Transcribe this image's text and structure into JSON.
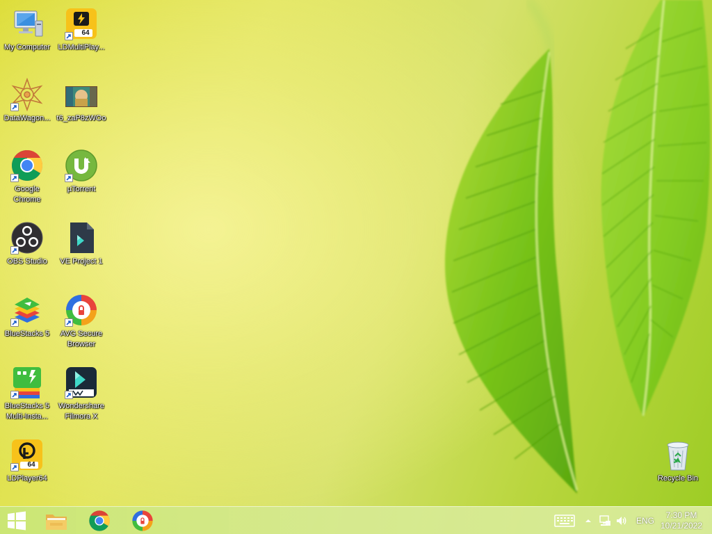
{
  "desktop": {
    "icons": [
      {
        "label": "My Computer",
        "icon": "computer-icon"
      },
      {
        "label": "LDMultiPlay...",
        "icon": "ldmultiplayer-icon",
        "badge": "64"
      },
      {
        "label": "DataWagon...",
        "icon": "datawagon-icon"
      },
      {
        "label": "t6_zaP8zWOo",
        "icon": "image-file-icon"
      },
      {
        "label": "Google Chrome",
        "icon": "chrome-icon"
      },
      {
        "label": "µTorrent",
        "icon": "utorrent-icon"
      },
      {
        "label": "OBS Studio",
        "icon": "obs-icon"
      },
      {
        "label": "VE Project 1",
        "icon": "ve-project-file-icon"
      },
      {
        "label": "BlueStacks 5",
        "icon": "bluestacks-icon"
      },
      {
        "label": "AVG Secure Browser",
        "icon": "avg-browser-icon"
      },
      {
        "label": "BlueStacks 5 Multi-Insta...",
        "icon": "bluestacks-multi-icon"
      },
      {
        "label": "Wondershare Filmora X",
        "icon": "filmora-icon"
      },
      {
        "label": "LDPlayer64",
        "icon": "ldplayer-icon",
        "badge": "64"
      },
      {
        "label": "Recycle Bin",
        "icon": "recycle-bin-icon"
      }
    ]
  },
  "taskbar": {
    "pinned": [
      {
        "name": "start-button",
        "icon": "windows-logo-icon"
      },
      {
        "name": "file-explorer",
        "icon": "folder-icon"
      },
      {
        "name": "google-chrome",
        "icon": "chrome-icon"
      },
      {
        "name": "avg-secure-browser",
        "icon": "avg-browser-icon"
      }
    ],
    "tray": {
      "language": "ENG",
      "time": "7:30 PM",
      "date": "10/21/2022"
    }
  },
  "colors": {
    "wallpaper_yellow": "#e3e660",
    "wallpaper_green": "#9ccc24",
    "leaf_green": "#7cc21c"
  }
}
